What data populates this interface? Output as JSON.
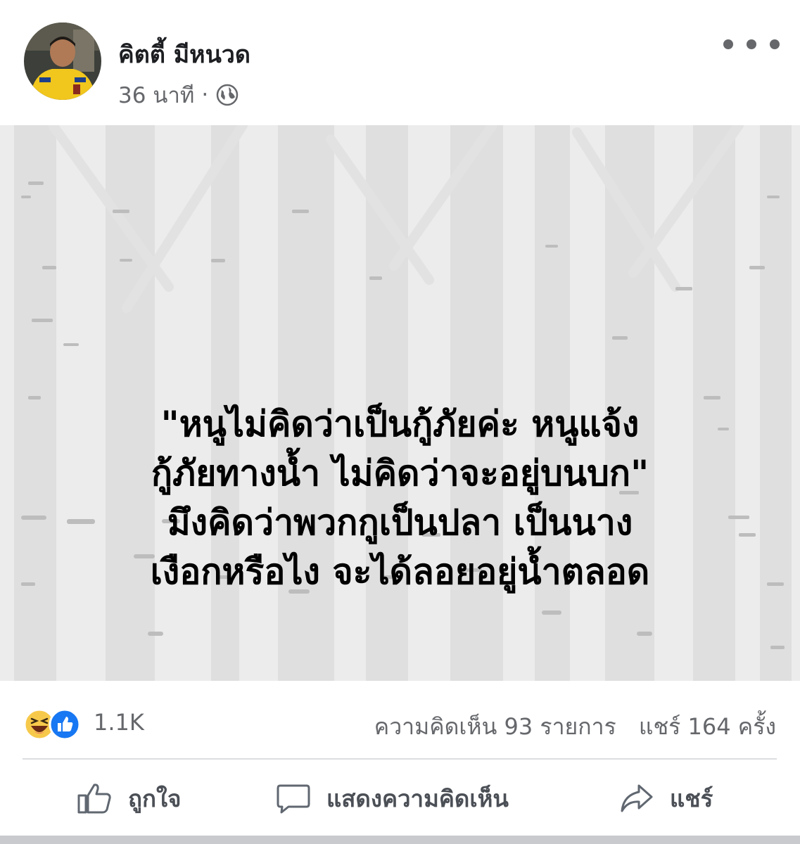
{
  "post": {
    "author_name": "คิตตี้ มีหนวด",
    "timestamp": "36 นาที",
    "meta_separator": "·",
    "privacy_icon": "globe-icon",
    "more_icon": "more-options-icon",
    "text_lines": [
      "\"หนูไม่คิดว่าเป็นกู้ภัยค่ะ หนูแจ้ง",
      "กู้ภัยทางน้ำ ไม่คิดว่าจะอยู่บนบก\"",
      "มึงคิดว่าพวกกูเป็นปลา เป็นนาง",
      "เงือกหรือไง จะได้ลอยอยู่น้ำตลอด"
    ]
  },
  "stats": {
    "reaction_icons": [
      "haha-icon",
      "like-icon"
    ],
    "reaction_count": "1.1K",
    "comments": "ความคิดเห็น 93 รายการ",
    "shares": "แชร์ 164 ครั้ง"
  },
  "actions": {
    "like_label": "ถูกใจ",
    "comment_label": "แสดงความคิดเห็น",
    "share_label": "แชร์"
  },
  "colors": {
    "text_primary": "#1c1e21",
    "text_secondary": "#65676b",
    "like_blue": "#1877f2",
    "haha_yellow": "#f7c94b",
    "post_background": "#ececec"
  }
}
